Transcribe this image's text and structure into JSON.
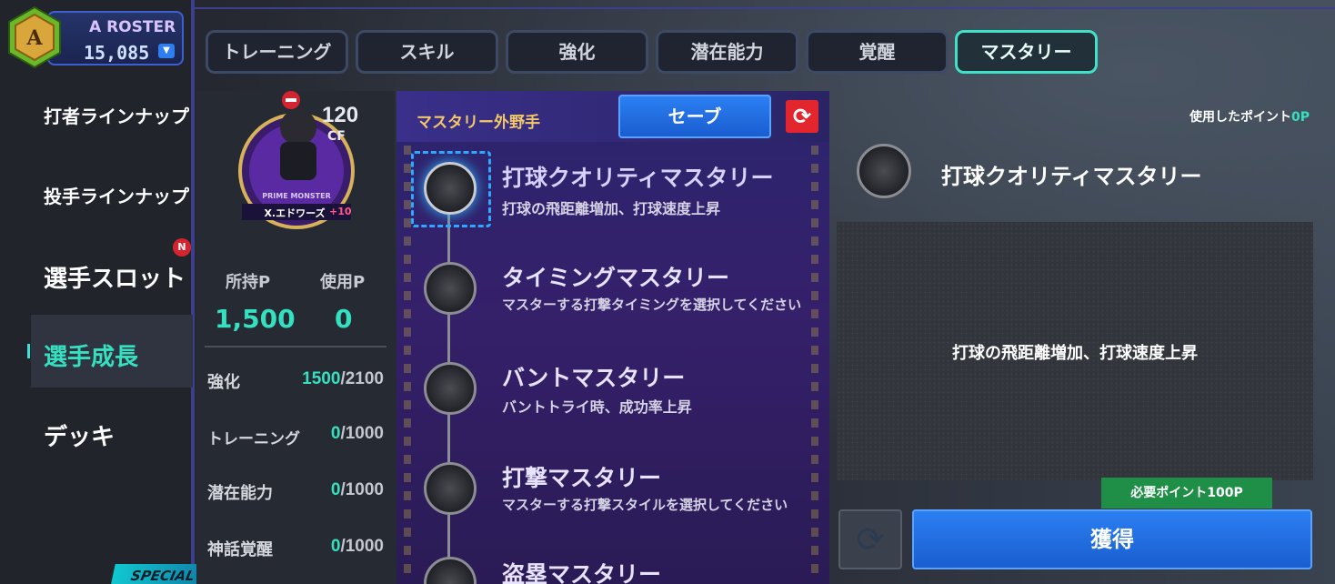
{
  "roster": {
    "grade": "A",
    "label": "A ROSTER",
    "value": "15,085"
  },
  "sidebar": {
    "items": [
      {
        "label": "打者ラインナップ"
      },
      {
        "label": "投手ラインナップ"
      },
      {
        "label": "選手スロット",
        "badge": "N"
      },
      {
        "label": "選手成長",
        "active": true
      },
      {
        "label": "デッキ"
      }
    ],
    "special_label": "SPECIAL"
  },
  "tabs": [
    {
      "label": "トレーニング"
    },
    {
      "label": "スキル"
    },
    {
      "label": "強化"
    },
    {
      "label": "潜在能力"
    },
    {
      "label": "覚醒"
    },
    {
      "label": "マスタリー",
      "active": true
    }
  ],
  "player": {
    "overall": "120",
    "position": "CF",
    "series": "PRIME MONSTER",
    "name": "X.エドワーズ",
    "plus": "+10",
    "owned_label": "所持P",
    "used_label": "使用P",
    "owned_value": "1,500",
    "used_value": "0",
    "rows": [
      {
        "label": "強化",
        "current": "1500",
        "max": "/2100"
      },
      {
        "label": "トレーニング",
        "current": "0",
        "max": "/1000"
      },
      {
        "label": "潜在能力",
        "current": "0",
        "max": "/1000"
      },
      {
        "label": "神話覚醒",
        "current": "0",
        "max": "/1000"
      }
    ]
  },
  "mastery": {
    "title": "マスタリー外野手",
    "save_label": "セーブ",
    "items": [
      {
        "title": "打球クオリティマスタリー",
        "desc": "打球の飛距離増加、打球速度上昇",
        "selected": true
      },
      {
        "title": "タイミングマスタリー",
        "desc": "マスターする打撃タイミングを選択してください"
      },
      {
        "title": "バントマスタリー",
        "desc": "バントトライ時、成功率上昇"
      },
      {
        "title": "打撃マスタリー",
        "desc": "マスターする打撃スタイルを選択してください"
      },
      {
        "title": "盗塁マスタリー",
        "desc": ""
      }
    ]
  },
  "detail": {
    "used_points_label": "使用したポイント",
    "used_points_value": "0P",
    "title": "打球クオリティマスタリー",
    "description": "打球の飛距離増加、打球速度上昇",
    "required_points": "必要ポイント100P",
    "acquire_label": "獲得"
  },
  "colors": {
    "accent": "#35e0c0",
    "button_blue": "#2b7ff2",
    "active_tab_border": "#3ee2c8"
  }
}
